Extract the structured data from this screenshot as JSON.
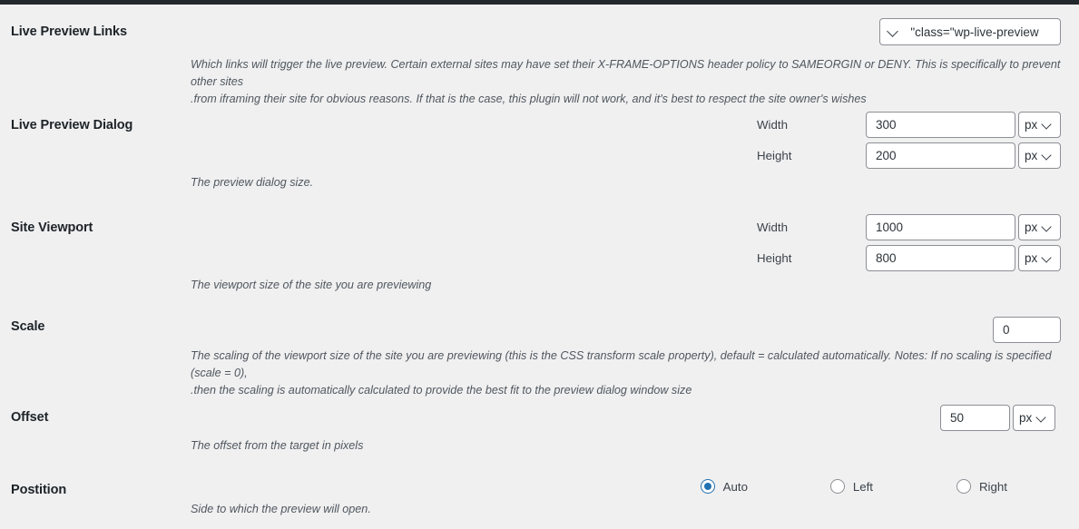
{
  "admin_bar": {
    "color": "#23282d"
  },
  "theme": {
    "page_background": "#f0f0f1",
    "accent": "#2271b1",
    "input_border": "#8c8f94",
    "heading_color": "#1d2327",
    "description_color": "#50575e"
  },
  "sections": {
    "live_preview_links": {
      "title": "Live Preview Links",
      "selector": {
        "value": "\"class=\"wp-live-preview",
        "icon": "chevron-down-icon"
      },
      "description_line1": "Which links will trigger the live preview. Certain external sites may have set their X-FRAME-OPTIONS header policy to SAMEORGIN or DENY. This is specifically to prevent other sites",
      "description_line2": ".from iframing their site for obvious reasons. If that is the case, this plugin will not work, and it's best to respect the site owner's wishes"
    },
    "live_preview_dialog": {
      "title": "Live Preview Dialog",
      "width": {
        "label": "Width",
        "value": "300",
        "unit": "px",
        "icon": "chevron-down-icon"
      },
      "height": {
        "label": "Height",
        "value": "200",
        "unit": "px",
        "icon": "chevron-down-icon"
      },
      "description": ".The preview dialog size"
    },
    "site_viewport": {
      "title": "Site Viewport",
      "width": {
        "label": "Width",
        "value": "1000",
        "unit": "px",
        "icon": "chevron-down-icon"
      },
      "height": {
        "label": "Height",
        "value": "800",
        "unit": "px",
        "icon": "chevron-down-icon"
      },
      "description": "The viewport size of the site you are previewing"
    },
    "scale": {
      "title": "Scale",
      "value": "0",
      "description_line1": "The scaling of the viewport size of the site you are previewing (this is the CSS transform scale property), default = calculated automatically. Notes: If no scaling is specified (scale = 0),",
      "description_line2": ".then the scaling is automatically calculated to provide the best fit to the preview dialog window size"
    },
    "offset": {
      "title": "Offset",
      "value": "50",
      "unit": "px",
      "icon": "chevron-down-icon",
      "description": "The offset from the target in pixels"
    },
    "position": {
      "title": "Postition",
      "options": [
        {
          "label": "Right",
          "selected": false
        },
        {
          "label": "Left",
          "selected": false
        },
        {
          "label": "Auto",
          "selected": true
        }
      ],
      "description": ".Side to which the preview will open"
    }
  }
}
